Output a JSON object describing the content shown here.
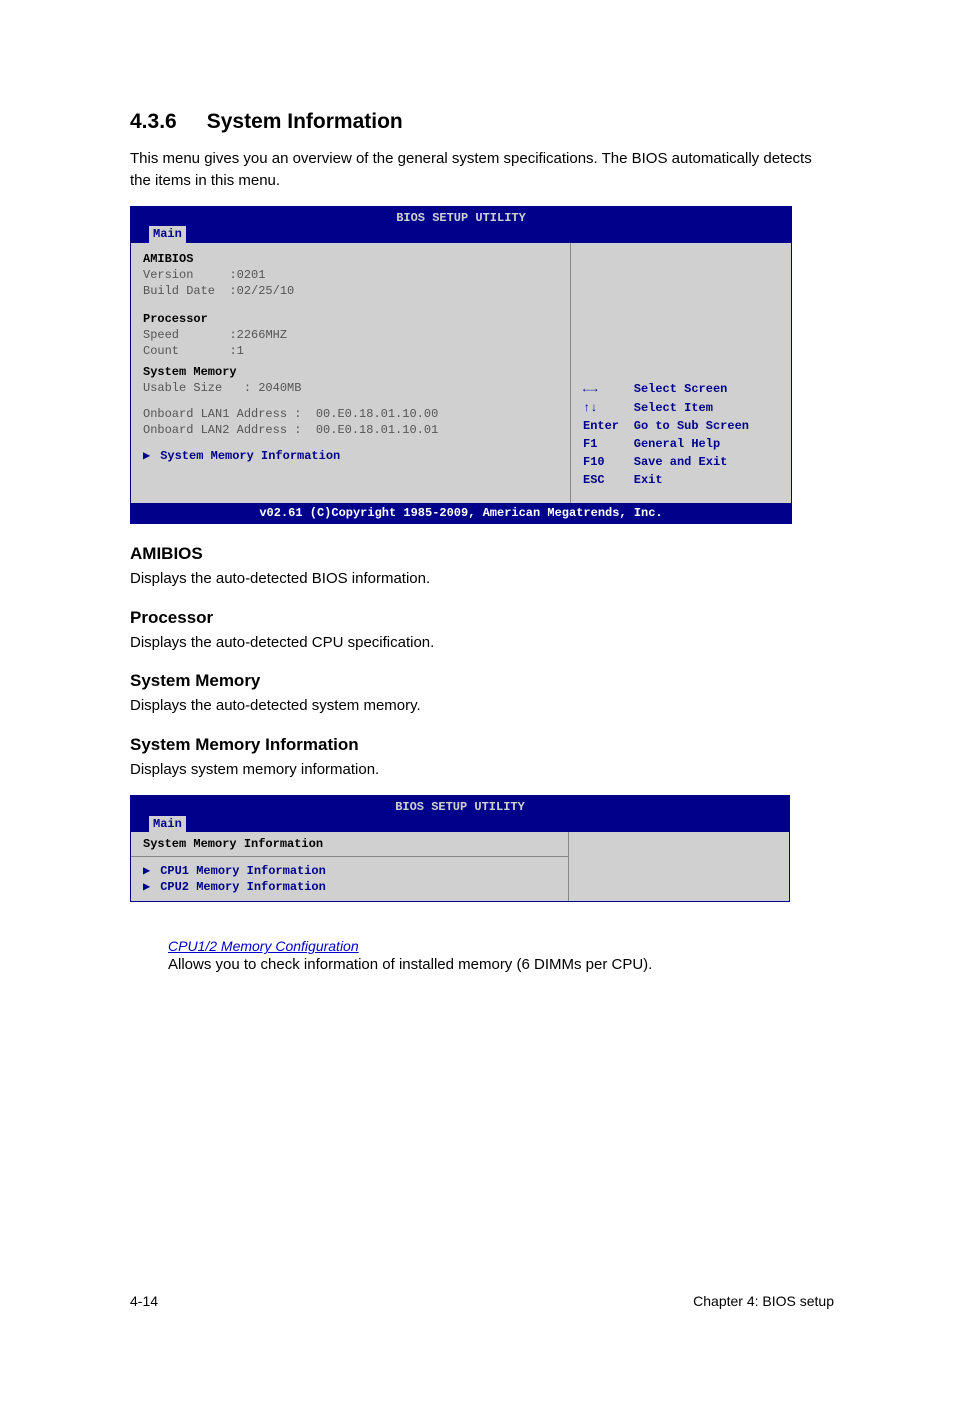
{
  "section": {
    "number": "4.3.6",
    "title": "System Information",
    "intro": "This menu gives you an overview of the general system specifications. The BIOS automatically detects the items in this menu."
  },
  "bios1": {
    "title": "BIOS SETUP UTILITY",
    "tab": "Main",
    "amibios": {
      "heading": "AMIBIOS",
      "version_label": "Version",
      "version_value": ":0201",
      "build_label": "Build Date",
      "build_value": ":02/25/10"
    },
    "processor": {
      "heading": "Processor",
      "speed_label": "Speed",
      "speed_value": ":2266MHZ",
      "count_label": "Count",
      "count_value": ":1"
    },
    "memory": {
      "heading": "System Memory",
      "usable_label": "Usable Size",
      "usable_value": ": 2040MB"
    },
    "lan1_label": "Onboard LAN1 Address  :",
    "lan1_value": "00.E0.18.01.10.00",
    "lan2_label": "Onboard LAN2 Address  :",
    "lan2_value": "00.E0.18.01.10.01",
    "submenu": "System Memory Information",
    "help": {
      "select_screen_key": "←→",
      "select_screen": "Select Screen",
      "select_item_key": "↑↓",
      "select_item": "Select Item",
      "enter_key": "Enter",
      "enter": "Go to Sub Screen",
      "f1_key": "F1",
      "f1": "General Help",
      "f10_key": "F10",
      "f10": "Save and Exit",
      "esc_key": "ESC",
      "esc": "Exit"
    },
    "footer": "v02.61 (C)Copyright 1985-2009, American Megatrends, Inc."
  },
  "subsections": {
    "amibios_h": "AMIBIOS",
    "amibios_p": "Displays the auto-detected BIOS information.",
    "processor_h": "Processor",
    "processor_p": "Displays the auto-detected CPU specification.",
    "sysmem_h": "System Memory",
    "sysmem_p": "Displays the auto-detected system memory.",
    "sysmeminfo_h": "System Memory Information",
    "sysmeminfo_p": "Displays system memory information."
  },
  "bios2": {
    "title": "BIOS SETUP UTILITY",
    "tab": "Main",
    "heading": "System Memory Information",
    "cpu1": "CPU1 Memory Information",
    "cpu2": "CPU2 Memory Information"
  },
  "cpu_link": {
    "title": "CPU1/2 Memory Configuration",
    "desc": "Allows you to check information of installed memory (6 DIMMs per CPU)."
  },
  "footer": {
    "left": "4-14",
    "right": "Chapter 4: BIOS setup"
  }
}
